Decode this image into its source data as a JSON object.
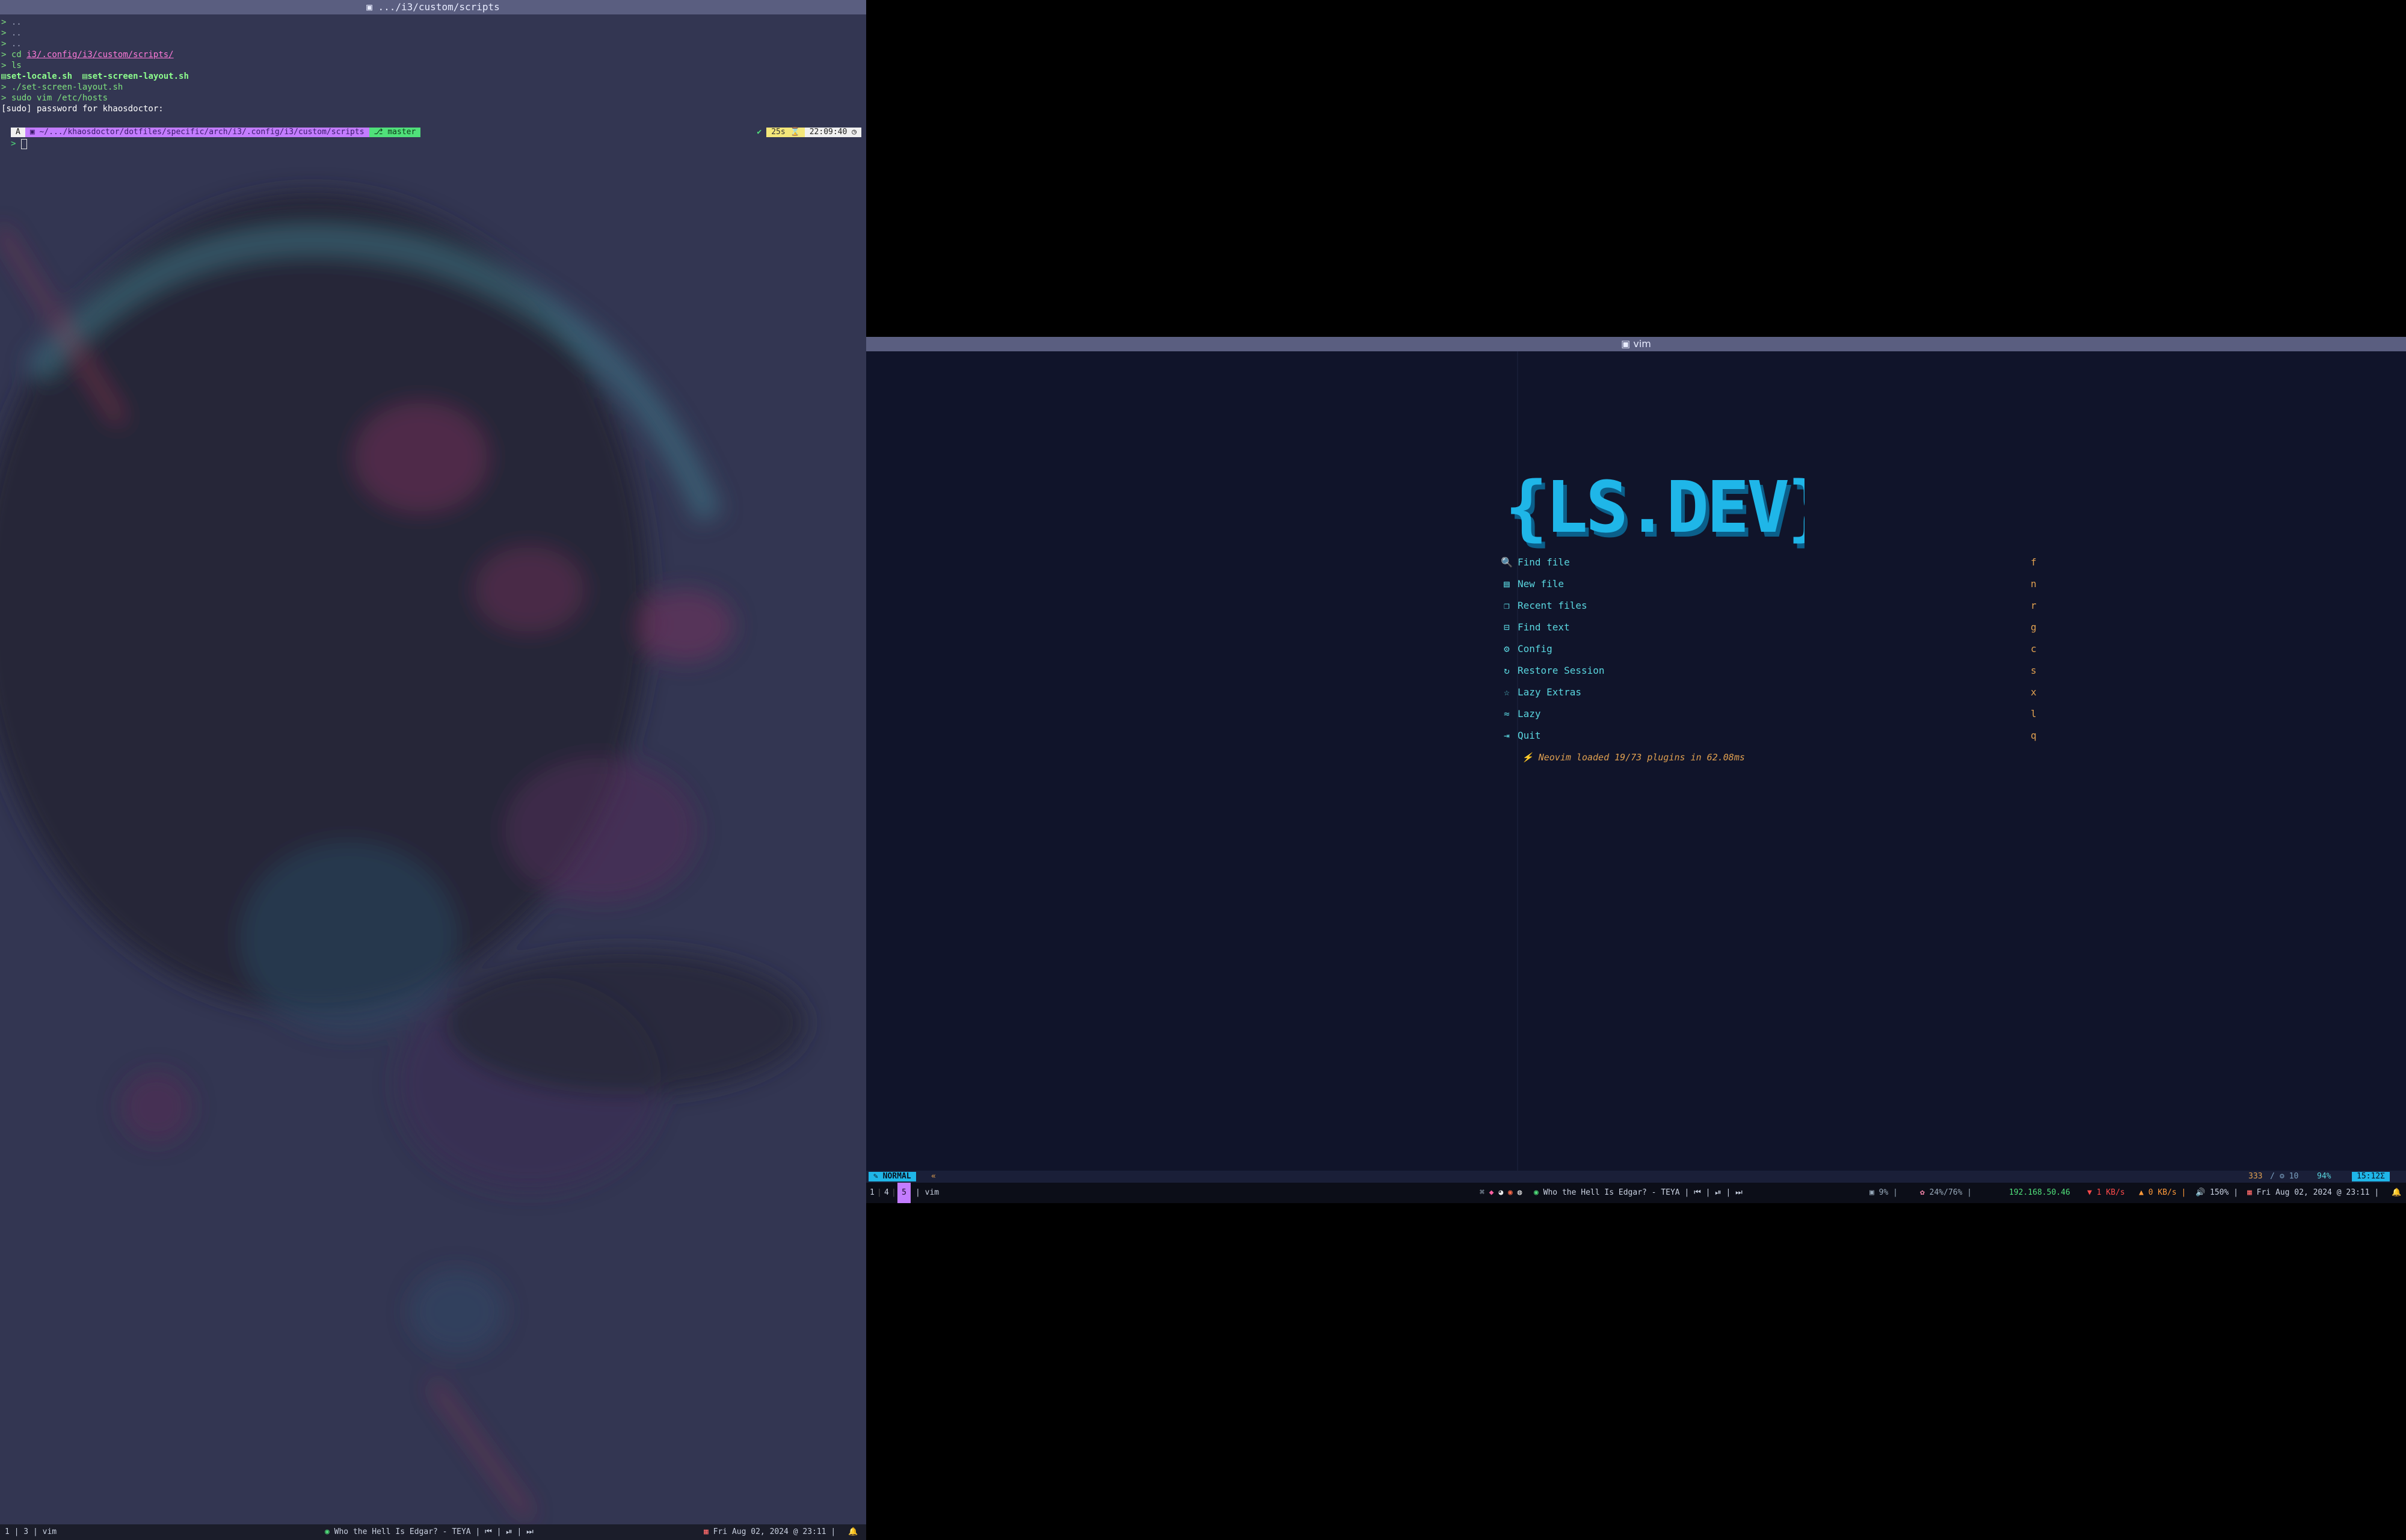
{
  "left_terminal": {
    "window_title": ".../i3/custom/scripts",
    "lines": [
      {
        "prompt": ">",
        "text": " .."
      },
      {
        "prompt": ">",
        "text": " .."
      },
      {
        "prompt": ">",
        "text": " .."
      },
      {
        "prompt": ">",
        "cmd": "cd",
        "arg": "i3/.config/i3/custom/scripts/"
      },
      {
        "prompt": ">",
        "cmd": "ls"
      }
    ],
    "ls_files": [
      "set-locale.sh",
      "set-screen-layout.sh"
    ],
    "cmd_run": "./set-screen-layout.sh",
    "cmd_sudo": "sudo vim /etc/hosts",
    "sudo_prompt": "[sudo] password for khaosdoctor:",
    "powerline": {
      "os_glyph": "A",
      "path": "~/.../khaosdoctor/dotfiles/specific/arch/i3/.config/i3/custom/scripts",
      "branch": "master",
      "status_ok": "✔",
      "duration": "25s ⌛",
      "time": "22:09:40 ◷"
    },
    "cursor_prompt": ">"
  },
  "left_bar": {
    "workspaces": "1 | 3 | vim",
    "now_playing": "Who the Hell Is Edgar? - TEYA | ⏮ | ⏯ | ⏭",
    "datetime": "Fri Aug 02, 2024 @ 23:11",
    "bell": "🔔"
  },
  "vim": {
    "window_title": "vim",
    "logo_text": "{LS.DEV}",
    "menu": [
      {
        "icon": "search-icon",
        "glyph": "🔍",
        "label": "Find file",
        "key": "f"
      },
      {
        "icon": "file-icon",
        "glyph": "▤",
        "label": "New file",
        "key": "n"
      },
      {
        "icon": "recent-files-icon",
        "glyph": "❐",
        "label": "Recent files",
        "key": "r"
      },
      {
        "icon": "find-text-icon",
        "glyph": "⊟",
        "label": "Find text",
        "key": "g"
      },
      {
        "icon": "gear-icon",
        "glyph": "⚙",
        "label": "Config",
        "key": "c"
      },
      {
        "icon": "restore-icon",
        "glyph": "↻",
        "label": "Restore Session",
        "key": "s"
      },
      {
        "icon": "extras-icon",
        "glyph": "☆",
        "label": "Lazy Extras",
        "key": "x"
      },
      {
        "icon": "lazy-icon",
        "glyph": "≈",
        "label": "Lazy",
        "key": "l"
      },
      {
        "icon": "quit-icon",
        "glyph": "⇥",
        "label": "Quit",
        "key": "q"
      }
    ],
    "loaded_text": "⚡ Neovim loaded 19/73 plugins in 62.08ms",
    "status": {
      "mode": "NORMAL",
      "arrow": "«",
      "count": "333",
      "sep": "/",
      "plugins": "10",
      "percent": "94%",
      "clock": "15:12Σ"
    }
  },
  "right_bar": {
    "workspaces": [
      "1",
      "4",
      "5"
    ],
    "active_workspace": "5",
    "window_name": "vim",
    "now_playing": "Who the Hell Is Edgar? - TEYA | ⏮ | ⏯ | ⏭",
    "cpu": "9%",
    "mem": "24%/76%",
    "ip": "192.168.50.46",
    "down": "1 KB/s",
    "up": "0 KB/s",
    "volume": "150%",
    "datetime": "Fri Aug 02, 2024 @ 23:11",
    "bell": "🔔"
  },
  "colors": {
    "accent_cyan": "#1fb6e8",
    "powerline_purple": "#c37cff",
    "powerline_green": "#50e07a",
    "powerline_yellow": "#f4e77a",
    "menu_teal": "#5ad7e0",
    "key_orange": "#e0a050"
  }
}
